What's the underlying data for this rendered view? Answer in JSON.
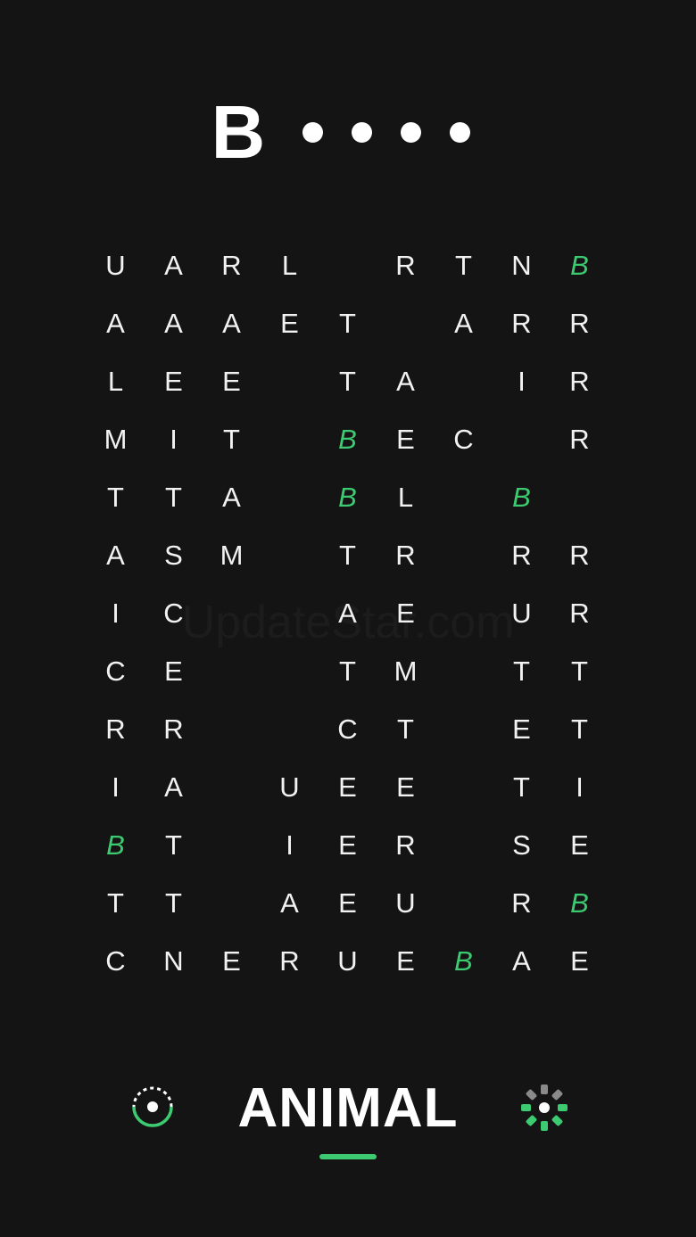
{
  "word": {
    "revealed_letter": "B",
    "hidden_count": 4
  },
  "grid": {
    "rows": [
      [
        "U",
        "A",
        "R",
        "L",
        "",
        "R",
        "T",
        "N",
        "B"
      ],
      [
        "A",
        "A",
        "A",
        "E",
        "T",
        "",
        "A",
        "R",
        "R"
      ],
      [
        "L",
        "E",
        "E",
        "",
        "T",
        "A",
        "",
        "I",
        "R"
      ],
      [
        "M",
        "I",
        "T",
        "",
        "B",
        "E",
        "C",
        "",
        "R"
      ],
      [
        "T",
        "T",
        "A",
        "",
        "B",
        "L",
        "",
        "B",
        ""
      ],
      [
        "A",
        "S",
        "M",
        "",
        "T",
        "R",
        "",
        "R",
        "R"
      ],
      [
        "I",
        "C",
        "",
        "",
        "A",
        "E",
        "",
        "U",
        "R"
      ],
      [
        "C",
        "E",
        "",
        "",
        "T",
        "M",
        "",
        "T",
        "T"
      ],
      [
        "R",
        "R",
        "",
        "",
        "C",
        "T",
        "",
        "E",
        "T"
      ],
      [
        "I",
        "A",
        "",
        "U",
        "E",
        "E",
        "",
        "T",
        "I"
      ],
      [
        "B",
        "T",
        "",
        "I",
        "E",
        "R",
        "",
        "S",
        "E"
      ],
      [
        "T",
        "T",
        "",
        "A",
        "E",
        "U",
        "",
        "R",
        "B"
      ],
      [
        "C",
        "N",
        "E",
        "R",
        "U",
        "E",
        "B",
        "A",
        "E"
      ]
    ],
    "highlighted": [
      [
        0,
        8
      ],
      [
        3,
        4
      ],
      [
        4,
        4
      ],
      [
        4,
        7
      ],
      [
        10,
        0
      ],
      [
        11,
        8
      ],
      [
        12,
        6
      ]
    ]
  },
  "watermark": "UpdateStar.com",
  "category": "ANIMAL",
  "icons": {
    "left": "target-icon",
    "right": "gear-icon"
  },
  "colors": {
    "background": "#141414",
    "text": "#ffffff",
    "accent": "#3dcb72",
    "muted": "#8a8a8a"
  }
}
